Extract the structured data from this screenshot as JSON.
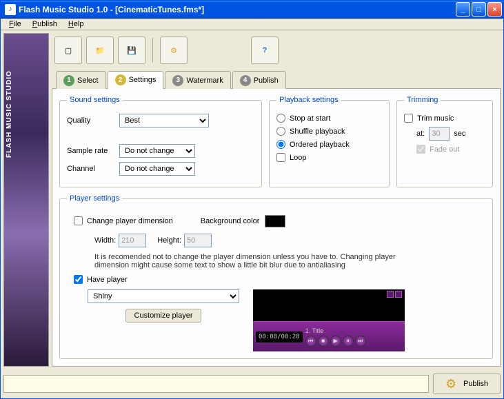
{
  "window": {
    "title": "Flash Music Studio 1.0 - [CinematicTunes.fms*]"
  },
  "menu": {
    "file": "File",
    "publish": "Publish",
    "help": "Help"
  },
  "tabs": {
    "t1": "Select",
    "t2": "Settings",
    "t3": "Watermark",
    "t4": "Publish"
  },
  "sound": {
    "legend": "Sound settings",
    "quality_label": "Quality",
    "quality_value": "Best",
    "samplerate_label": "Sample rate",
    "samplerate_value": "Do not change",
    "channel_label": "Channel",
    "channel_value": "Do not change"
  },
  "playback": {
    "legend": "Playback settings",
    "stop": "Stop at start",
    "shuffle": "Shuffle playback",
    "ordered": "Ordered playback",
    "loop": "Loop"
  },
  "trimming": {
    "legend": "Trimming",
    "trim_label": "Trim music",
    "at_label": "at:",
    "at_value": "30",
    "sec": "sec",
    "fade": "Fade out"
  },
  "player": {
    "legend": "Player settings",
    "change_dim": "Change player dimension",
    "bg_label": "Background color",
    "width_label": "Width:",
    "width_value": "210",
    "height_label": "Height:",
    "height_value": "50",
    "note": "It is recomended not to change the player dimension unless you have to. Changing player dimension might cause some text to show a little bit blur due to antialiasing",
    "have_player": "Have player",
    "skin": "Shiny",
    "customize": "Customize player"
  },
  "preview": {
    "time": "00:08/00:28",
    "track": "1. Title"
  },
  "bottom": {
    "publish": "Publish"
  },
  "sidebar": {
    "label": "FLASH MUSIC STUDIO"
  }
}
